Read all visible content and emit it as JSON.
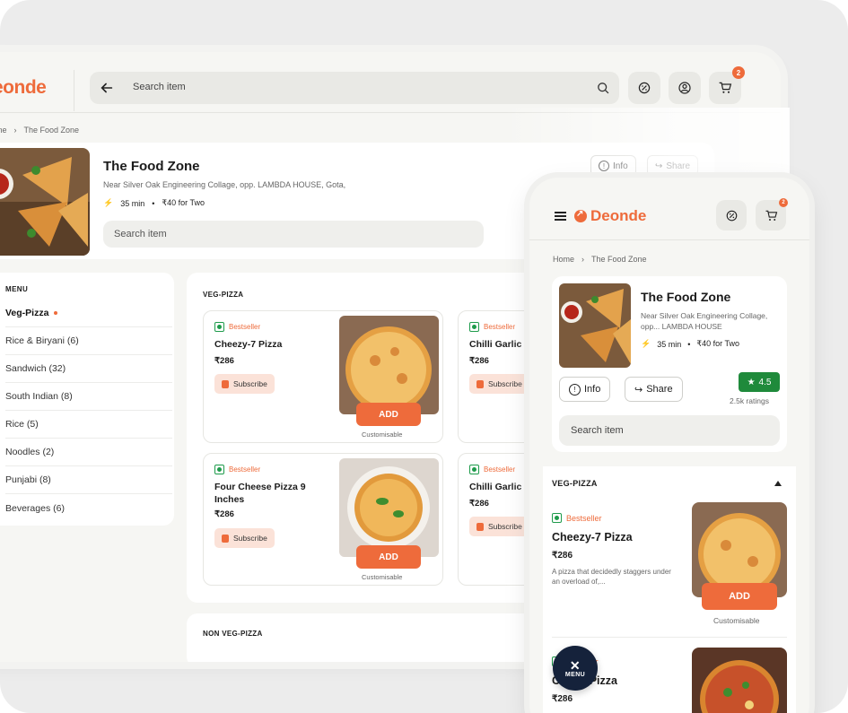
{
  "brand": {
    "name": "Deonde",
    "desktop_name": "eonde",
    "color": "#ee6b3b"
  },
  "desktop": {
    "search_placeholder": "Search item",
    "cart_count": "2",
    "breadcrumb": {
      "home": "ome",
      "current": "The Food Zone"
    },
    "restaurant": {
      "name": "The Food Zone",
      "address": "Near Silver Oak Engineering Collage, opp. LAMBDA HOUSE, Gota,",
      "time": "35 min",
      "cost": "₹40 for Two",
      "search_placeholder": "Search item",
      "info_label": "Info",
      "share_label": "Share"
    },
    "menu": {
      "heading": "MENU",
      "items": [
        {
          "label": "Veg-Pizza"
        },
        {
          "label": "Rice & Biryani (6)"
        },
        {
          "label": "Sandwich (32)"
        },
        {
          "label": "South Indian (8)"
        },
        {
          "label": "Rice (5)"
        },
        {
          "label": "Noodles (2)"
        },
        {
          "label": "Punjabi (8)"
        },
        {
          "label": "Beverages (6)"
        }
      ]
    },
    "section_title": "VEG-PIZZA",
    "section2_title": "NON VEG-PIZZA",
    "cards": [
      {
        "badge": "Bestseller",
        "name": "Cheezy-7 Pizza",
        "price": "₹286",
        "subscribe": "Subscribe",
        "add": "ADD",
        "custom": "Customisable"
      },
      {
        "badge": "Bestseller",
        "name": "Chilli Garlic P",
        "price": "₹286",
        "subscribe": "Subscribe"
      },
      {
        "badge": "Bestseller",
        "name": "Four Cheese Pizza 9 Inches",
        "price": "₹286",
        "subscribe": "Subscribe",
        "add": "ADD",
        "custom": "Customisable"
      },
      {
        "badge": "Bestseller",
        "name": "Chilli Garlic P",
        "price": "₹286",
        "subscribe": "Subscribe"
      }
    ]
  },
  "phone": {
    "cart_count": "2",
    "breadcrumb": {
      "home": "Home",
      "current": "The Food Zone"
    },
    "restaurant": {
      "name": "The Food Zone",
      "address": "Near Silver Oak Engineering Collage, opp... LAMBDA HOUSE",
      "time": "35 min",
      "cost": "₹40 for Two",
      "info_label": "Info",
      "share_label": "Share",
      "rating": "4.5",
      "ratings_count": "2.5k ratings",
      "search_placeholder": "Search item"
    },
    "section_title": "VEG-PIZZA",
    "item1": {
      "badge": "Bestseller",
      "name": "Cheezy-7 Pizza",
      "price": "₹286",
      "desc": "A pizza that decidedly staggers under an overload of,...",
      "add": "ADD",
      "custom": "Customisable"
    },
    "item2": {
      "badge": "lestseller",
      "name": "arlic Pizza",
      "name_prefix": "C",
      "price": "₹286"
    },
    "fab_label": "MENU"
  }
}
